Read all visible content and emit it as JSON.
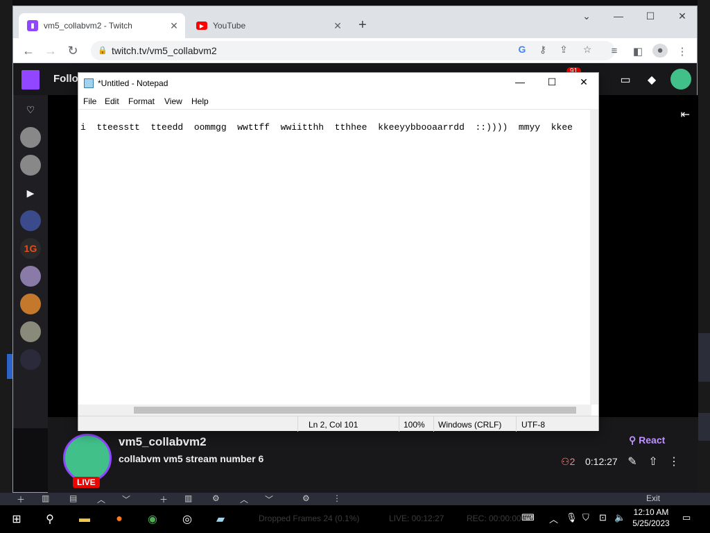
{
  "browser": {
    "tabs": [
      {
        "title": "vm5_collabvm2 - Twitch",
        "active": true
      },
      {
        "title": "YouTube",
        "active": false
      }
    ],
    "url": "twitch.tv/vm5_collabvm2",
    "icons": [
      "back-icon",
      "forward-icon",
      "reload-icon",
      "lock-icon",
      "google-icon",
      "key-icon",
      "share-icon",
      "star-icon",
      "queue-icon",
      "sidepanel-icon",
      "profile-icon",
      "menu-icon"
    ]
  },
  "twitch": {
    "header_label": "Follo",
    "notification_count": "91",
    "channel_name": "vm5_collabvm2",
    "stream_title": "collabvm vm5 stream number 6",
    "live_label": "LIVE",
    "react_label": "React",
    "viewer_count": "2",
    "uptime": "0:12:27"
  },
  "notepad": {
    "title": "*Untitled - Notepad",
    "menu": [
      "File",
      "Edit",
      "Format",
      "View",
      "Help"
    ],
    "content": "i  tteesstt  tteedd  oommgg  wwttff  wwiitthh  tthhee  kkeeyybbooaarrdd  ::))))  mmyy  kkee",
    "status": {
      "position": "Ln 2, Col 101",
      "zoom": "100%",
      "line_ending": "Windows (CRLF)",
      "encoding": "UTF-8"
    }
  },
  "obs": {
    "exit_label": "Exit",
    "dropped_frames": "Dropped Frames 24 (0.1%)",
    "live_time": "LIVE: 00:12:27",
    "rec_time": "REC: 00:00:00"
  },
  "taskbar": {
    "time": "12:10 AM",
    "date": "5/25/2023"
  },
  "colors": {
    "twitch_purple": "#9147ff",
    "live_red": "#eb0400",
    "avatar_green": "#41c08a"
  }
}
